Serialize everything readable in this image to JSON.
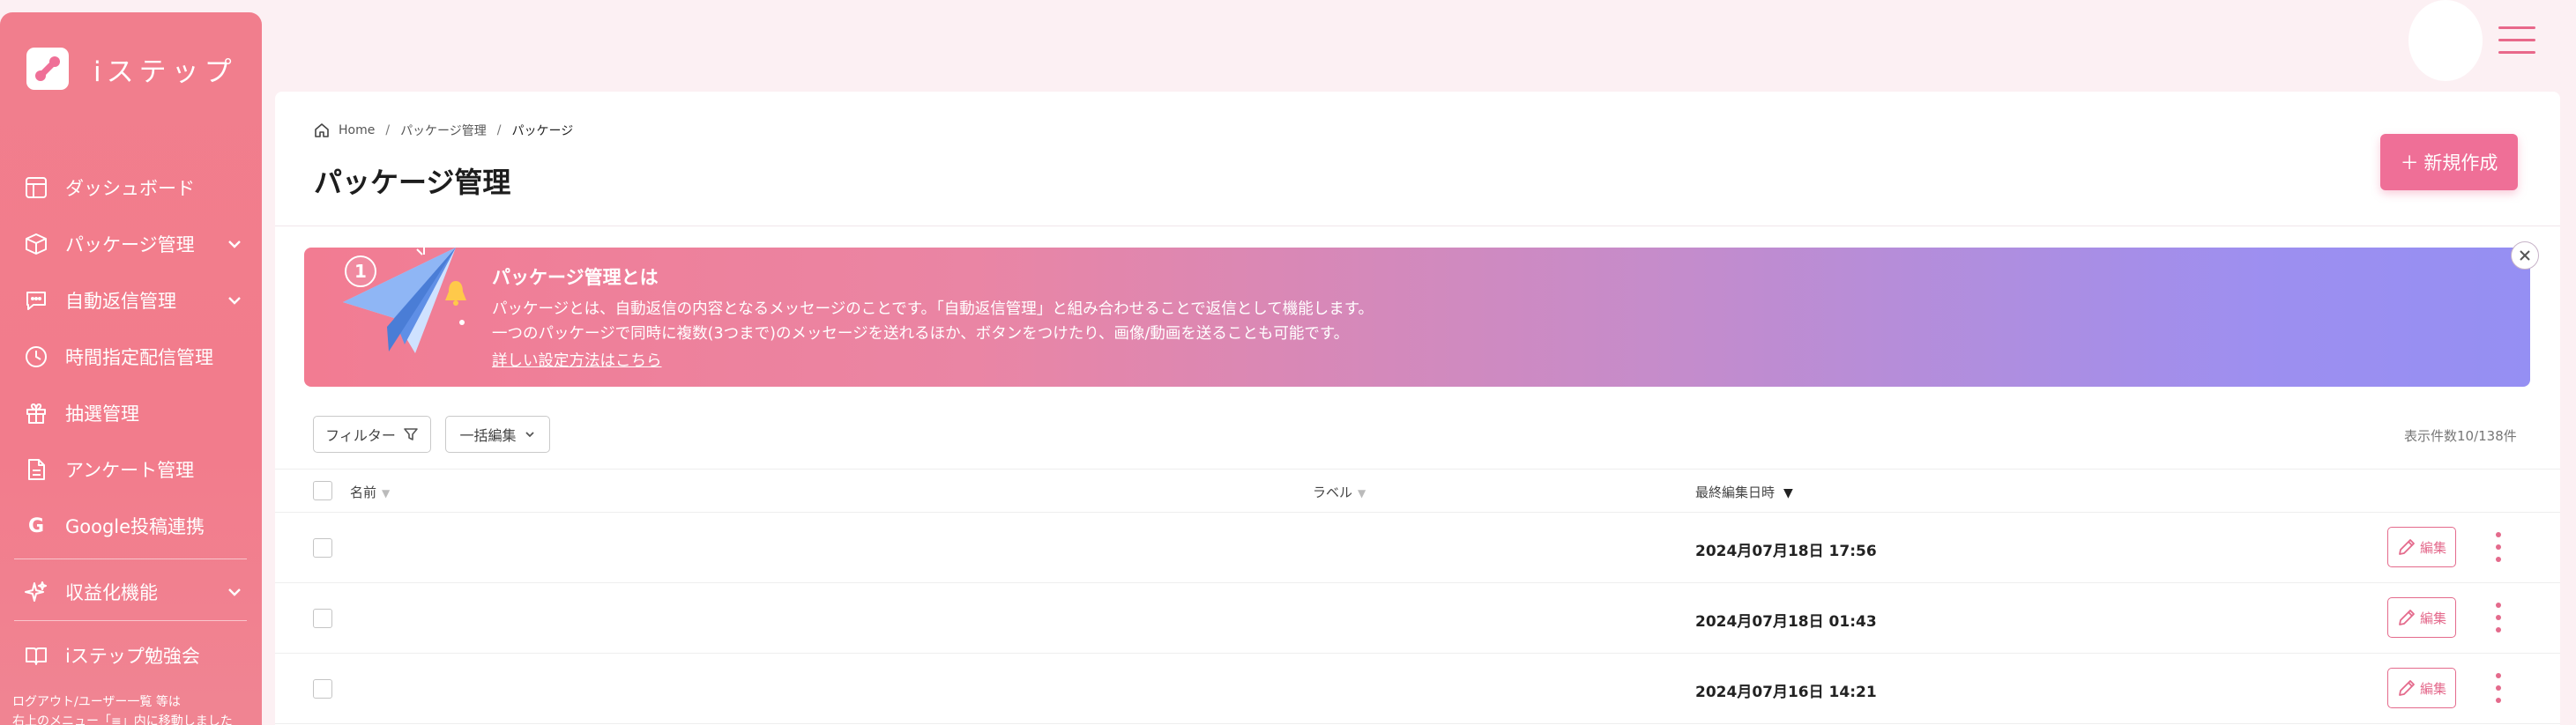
{
  "brand": {
    "name": "iステップ"
  },
  "sidebar": {
    "items": [
      {
        "label": "ダッシュボード",
        "icon": "dashboard-icon",
        "expandable": false
      },
      {
        "label": "パッケージ管理",
        "icon": "box-icon",
        "expandable": true
      },
      {
        "label": "自動返信管理",
        "icon": "chat-icon",
        "expandable": true
      },
      {
        "label": "時間指定配信管理",
        "icon": "clock-icon",
        "expandable": false
      },
      {
        "label": "抽選管理",
        "icon": "gift-icon",
        "expandable": false
      },
      {
        "label": "アンケート管理",
        "icon": "document-icon",
        "expandable": false
      },
      {
        "label": "Google投稿連携",
        "icon": "google-icon",
        "expandable": false
      },
      {
        "label": "収益化機能",
        "icon": "sparkle-icon",
        "expandable": true
      },
      {
        "label": "iステップ勉強会",
        "icon": "book-icon",
        "expandable": false
      }
    ],
    "note_line1": "ログアウト/ユーザー一覧 等は",
    "note_line2": "右上のメニュー「≡」内に移動しました"
  },
  "breadcrumb": {
    "home": "Home",
    "parent": "パッケージ管理",
    "current": "パッケージ"
  },
  "page_title": "パッケージ管理",
  "new_button": "＋ 新規作成",
  "banner": {
    "badge": "1",
    "title": "パッケージ管理とは",
    "line1": "パッケージとは、自動返信の内容となるメッセージのことです。「自動返信管理」と組み合わせることで返信として機能します。",
    "line2": "一つのパッケージで同時に複数(3つまで)のメッセージを送れるほか、ボタンをつけたり、画像/動画を送ることも可能です。",
    "link": "詳しい設定方法はこちら"
  },
  "toolbar": {
    "filter": "フィルター",
    "bulk_edit": "一括編集",
    "count": "表示件数10/138件"
  },
  "table": {
    "headers": {
      "name": "名前",
      "label": "ラベル",
      "updated": "最終編集日時"
    },
    "sort_markers": {
      "name": "▼",
      "label": "▼",
      "updated": "▼"
    },
    "rows": [
      {
        "name": "",
        "label": "",
        "updated": "2024月07月18日 17:56",
        "edit": "編集"
      },
      {
        "name": "",
        "label": "",
        "updated": "2024月07月18日 01:43",
        "edit": "編集"
      },
      {
        "name": "",
        "label": "",
        "updated": "2024月07月16日 14:21",
        "edit": "編集"
      }
    ]
  },
  "colors": {
    "primary": "#ef6f97",
    "sidebar": "#f17e8d",
    "accent": "#e46a8c",
    "banner_end": "#958ff3"
  }
}
